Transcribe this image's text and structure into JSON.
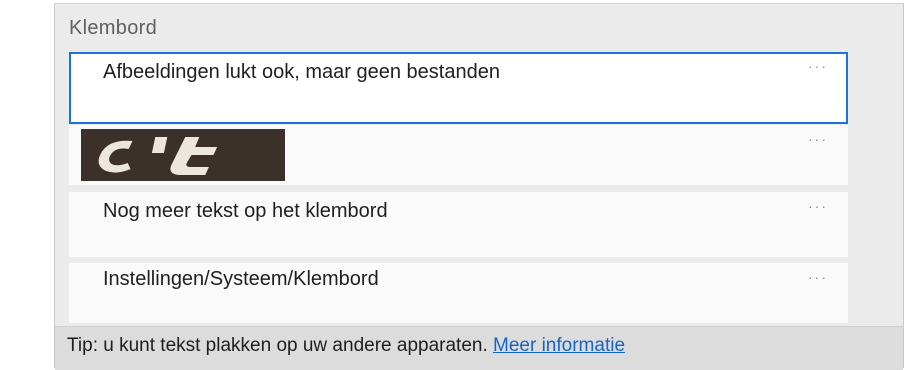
{
  "panel": {
    "title": "Klembord"
  },
  "items": [
    {
      "text": "Afbeeldingen lukt ook, maar geen bestanden",
      "more_label": "···",
      "selected": true
    },
    {
      "image": "ct-logo",
      "image_alt": "c't",
      "more_label": "···"
    },
    {
      "text": "Nog meer tekst op het klembord",
      "more_label": "···"
    },
    {
      "text": "Instellingen/Systeem/Klembord",
      "more_label": "···"
    }
  ],
  "footer": {
    "tip_text": "Tip: u kunt tekst plakken op uw andere apparaten.",
    "link_text": "Meer informatie"
  },
  "colors": {
    "accent": "#1a73d8",
    "link": "#1465c8",
    "panel_bg": "#ebebeb",
    "item_bg": "#fafafa",
    "footer_bg": "#dcdcdc"
  }
}
